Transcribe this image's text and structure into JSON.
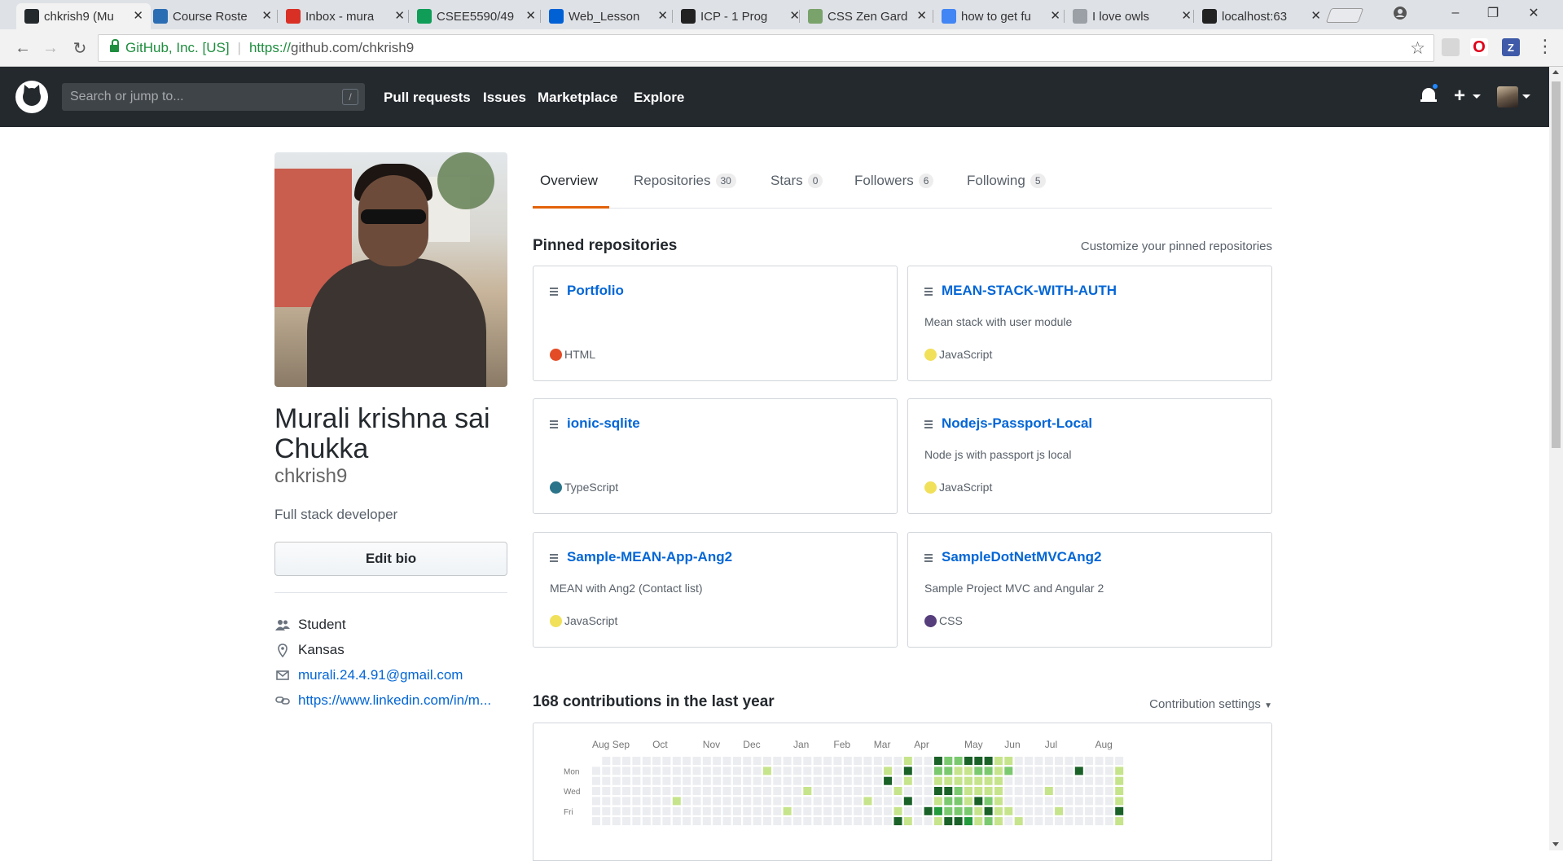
{
  "browser": {
    "tabs": [
      {
        "title": "chkrish9 (Mu",
        "favicon": "github-icon",
        "fav_color": "#24292e",
        "active": true
      },
      {
        "title": "Course Roste",
        "favicon": "umkc-icon",
        "fav_color": "#2b6db3",
        "active": false
      },
      {
        "title": "Inbox - mura",
        "favicon": "gmail-icon",
        "fav_color": "#d93025",
        "active": false
      },
      {
        "title": "CSEE5590/49",
        "favicon": "sheets-icon",
        "fav_color": "#0f9d58",
        "active": false
      },
      {
        "title": "Web_Lesson",
        "favicon": "box-icon",
        "fav_color": "#0061d5",
        "active": false
      },
      {
        "title": "ICP - 1 Prog",
        "favicon": "ws-icon",
        "fav_color": "#222222",
        "active": false
      },
      {
        "title": "CSS Zen Gard",
        "favicon": "zen-icon",
        "fav_color": "#7aa36b",
        "active": false
      },
      {
        "title": "how to get fu",
        "favicon": "google-icon",
        "fav_color": "#4285f4",
        "active": false
      },
      {
        "title": "I love owls",
        "favicon": "document-icon",
        "fav_color": "#9aa0a6",
        "active": false
      },
      {
        "title": "localhost:63",
        "favicon": "ws-icon",
        "fav_color": "#222222",
        "active": false
      }
    ],
    "security_label": "GitHub, Inc. [US]",
    "url_protocol": "https://",
    "url_rest": "github.com/chkrish9"
  },
  "header": {
    "search_placeholder": "Search or jump to...",
    "search_hotkey": "/",
    "nav": [
      "Pull requests",
      "Issues",
      "Marketplace",
      "Explore"
    ]
  },
  "profile": {
    "fullname": "Murali krishna sai Chukka",
    "username": "chkrish9",
    "bio": "Full stack developer",
    "edit_bio_label": "Edit bio",
    "company": "Student",
    "location": "Kansas",
    "email": "murali.24.4.91@gmail.com",
    "website": "https://www.linkedin.com/in/m..."
  },
  "tabs": {
    "overview": "Overview",
    "repositories": {
      "label": "Repositories",
      "count": "30"
    },
    "stars": {
      "label": "Stars",
      "count": "0"
    },
    "followers": {
      "label": "Followers",
      "count": "6"
    },
    "following": {
      "label": "Following",
      "count": "5"
    }
  },
  "pinned": {
    "title": "Pinned repositories",
    "customize": "Customize your pinned repositories",
    "repos": [
      {
        "name": "Portfolio",
        "desc": "",
        "lang": "HTML",
        "color": "#e34c26"
      },
      {
        "name": "MEAN-STACK-WITH-AUTH",
        "desc": "Mean stack with user module",
        "lang": "JavaScript",
        "color": "#f1e05a"
      },
      {
        "name": "ionic-sqlite",
        "desc": "",
        "lang": "TypeScript",
        "color": "#2b7489"
      },
      {
        "name": "Nodejs-Passport-Local",
        "desc": "Node js with passport js local",
        "lang": "JavaScript",
        "color": "#f1e05a"
      },
      {
        "name": "Sample-MEAN-App-Ang2",
        "desc": "MEAN with Ang2 (Contact list)",
        "lang": "JavaScript",
        "color": "#f1e05a"
      },
      {
        "name": "SampleDotNetMVCAng2",
        "desc": "Sample Project MVC and Angular 2",
        "lang": "CSS",
        "color": "#563d7c"
      }
    ]
  },
  "contributions": {
    "title": "168 contributions in the last year",
    "settings_label": "Contribution settings",
    "months": [
      "Aug",
      "Sep",
      "Oct",
      "Nov",
      "Dec",
      "Jan",
      "Feb",
      "Mar",
      "Apr",
      "May",
      "Jun",
      "Jul",
      "Aug"
    ],
    "day_labels": [
      "Mon",
      "Wed",
      "Fri"
    ],
    "colors": [
      "#ebedf0",
      "#c6e48b",
      "#7bc96f",
      "#239a3b",
      "#196127"
    ]
  }
}
